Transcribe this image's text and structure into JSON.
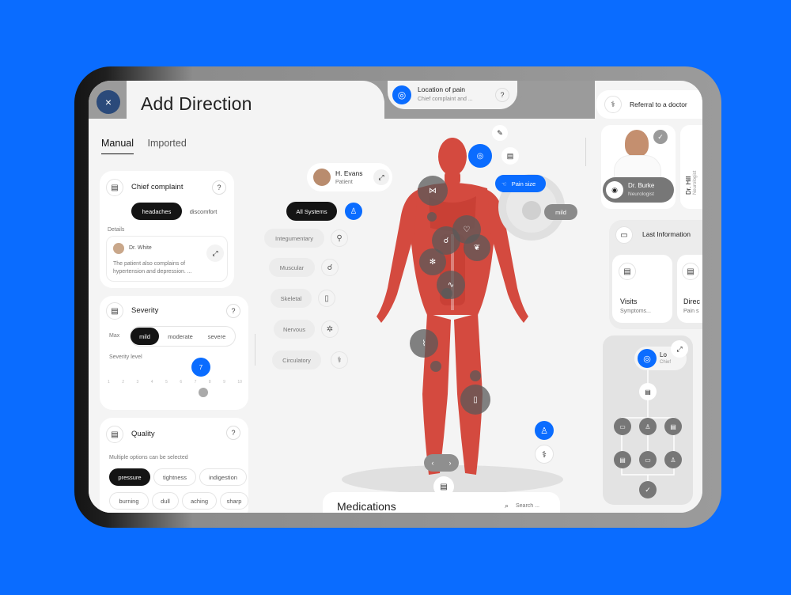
{
  "header": {
    "close_icon": "×",
    "title": "Add Direction"
  },
  "tabs": [
    {
      "label": "Manual"
    },
    {
      "label": "Imported"
    }
  ],
  "location_card": {
    "title": "Location of pain",
    "subtitle": "Chief complaint and ...",
    "help": "?"
  },
  "chief_complaint": {
    "title": "Chief complaint",
    "help": "?",
    "options": [
      "headaches",
      "discomfort"
    ],
    "details_label": "Details",
    "doctor": "Dr. White",
    "note": "The patient also complains of hypertension and depression. ..."
  },
  "severity": {
    "title": "Severity",
    "help": "?",
    "max_label": "Max",
    "options": [
      "mild",
      "moderate",
      "severe"
    ],
    "level_label": "Severity level",
    "level_value": "7",
    "level_fraction": 0.72,
    "scale": [
      "1",
      "2",
      "3",
      "4",
      "5",
      "6",
      "7",
      "8",
      "9",
      "10"
    ]
  },
  "quality": {
    "title": "Quality",
    "help": "?",
    "hint": "Multiple options can be selected",
    "options_row1": [
      "pressure",
      "tightness",
      "indigestion"
    ],
    "options_row2": [
      "burning",
      "dull",
      "aching",
      "sharp"
    ]
  },
  "patient": {
    "name": "H. Evans",
    "role": "Patient"
  },
  "systems": {
    "all": "All Systems",
    "items": [
      "Integumentary",
      "Muscular",
      "Skeletal",
      "Nervous",
      "Circulatory"
    ]
  },
  "pain_size": {
    "label": "Pain size",
    "value": "mild"
  },
  "medications": {
    "title": "Medications",
    "search_placeholder": "Search ..."
  },
  "right": {
    "referral": "Referral to a doctor",
    "doctor_name": "Dr. Burke",
    "doctor_role": "Neurologist",
    "doctor2_name": "Dr. Hill",
    "doctor2_role": "Neurologist",
    "last_info": "Last Information",
    "visits": "Visits",
    "visits_sub": "Symptoms...",
    "direc": "Direc",
    "direc_sub": "Pain s",
    "loc_title": "Lo",
    "loc_sub": "Chief"
  },
  "colors": {
    "accent": "#0a6cff",
    "dark": "#141414",
    "background": "#f4f4f4"
  }
}
